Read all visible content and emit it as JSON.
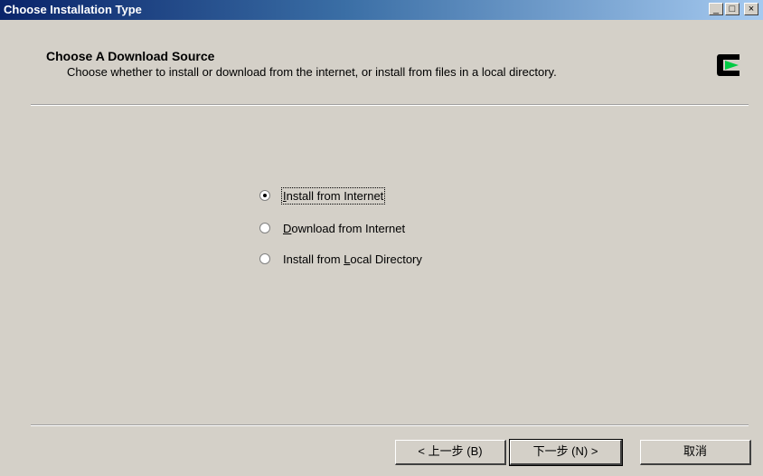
{
  "window": {
    "title": "Choose Installation Type",
    "minimize_glyph": "_",
    "maximize_glyph": "□",
    "close_glyph": "×"
  },
  "header": {
    "title": "Choose A Download Source",
    "subtitle": "Choose whether to install or download from the internet, or install from files in a local directory.",
    "logo_icon": "cygwin-logo-icon"
  },
  "options": [
    {
      "pre": "",
      "key": "I",
      "post": "nstall from Internet",
      "selected": true
    },
    {
      "pre": "",
      "key": "D",
      "post": "ownload from Internet",
      "selected": false
    },
    {
      "pre": "Install from ",
      "key": "L",
      "post": "ocal Directory",
      "selected": false
    }
  ],
  "buttons": {
    "back": "< 上一步 (B)",
    "next": "下一步 (N) >",
    "cancel": "取消"
  },
  "colors": {
    "title_start": "#0a246a",
    "title_end": "#a6caf0",
    "face": "#d4d0c8",
    "logo_green": "#00cc44"
  }
}
